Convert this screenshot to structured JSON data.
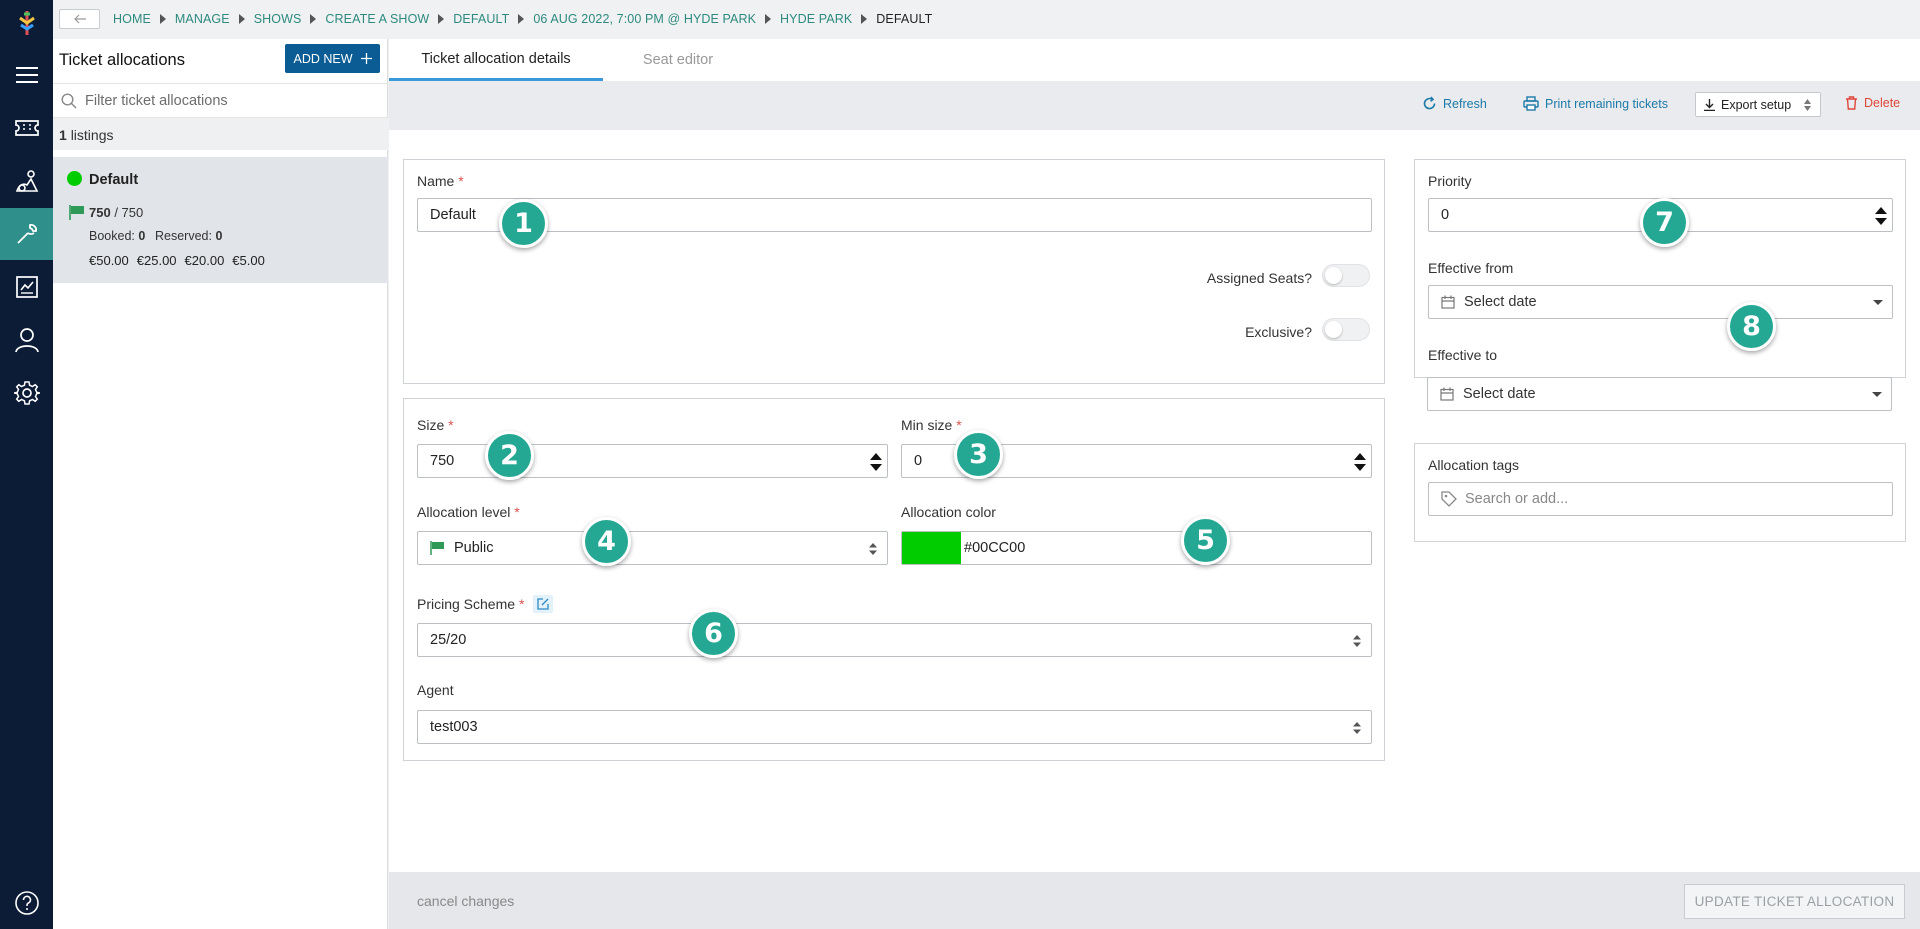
{
  "breadcrumb": [
    "HOME",
    "MANAGE",
    "SHOWS",
    "CREATE A SHOW",
    "DEFAULT",
    "06 AUG 2022, 7:00 PM @ HYDE PARK",
    "HYDE PARK"
  ],
  "breadcrumb_current": "DEFAULT",
  "sidebar": {
    "title": "Ticket allocations",
    "add_new_label": "ADD NEW",
    "filter_placeholder": "Filter ticket allocations",
    "count_number": "1",
    "count_label": "listings",
    "listing": {
      "name": "Default",
      "status_color": "#00CC00",
      "available": "750",
      "total": "/ 750",
      "booked_label": "Booked:",
      "booked": "0",
      "reserved_label": "Reserved:",
      "reserved": "0",
      "prices": [
        "€50.00",
        "€25.00",
        "€20.00",
        "€5.00"
      ]
    }
  },
  "tabs": [
    {
      "label": "Ticket allocation details",
      "active": true
    },
    {
      "label": "Seat editor",
      "active": false
    }
  ],
  "toolbar": {
    "refresh": "Refresh",
    "print": "Print remaining tickets",
    "export": "Export setup",
    "delete": "Delete"
  },
  "form": {
    "name_label": "Name",
    "name_value": "Default",
    "assigned_seats_label": "Assigned Seats?",
    "exclusive_label": "Exclusive?",
    "size_label": "Size",
    "size_value": "750",
    "min_size_label": "Min size",
    "min_size_value": "0",
    "allocation_level_label": "Allocation level",
    "allocation_level_value": "Public",
    "allocation_color_label": "Allocation color",
    "allocation_color_value": "#00CC00",
    "pricing_scheme_label": "Pricing Scheme",
    "pricing_scheme_value": "25/20",
    "agent_label": "Agent",
    "agent_value": "test003",
    "priority_label": "Priority",
    "priority_value": "0",
    "effective_from_label": "Effective from",
    "effective_from_placeholder": "Select date",
    "effective_to_label": "Effective to",
    "effective_to_placeholder": "Select date",
    "tags_label": "Allocation tags",
    "tags_placeholder": "Search or add..."
  },
  "required_mark": "*",
  "markers": [
    "1",
    "2",
    "3",
    "4",
    "5",
    "6",
    "7",
    "8"
  ],
  "footer": {
    "cancel": "cancel changes",
    "update": "UPDATE TICKET ALLOCATION"
  },
  "colors": {
    "rail": "#0c1c36",
    "accent": "#2c8a7e",
    "primary_button": "#0b5c94",
    "allocation_color": "#00CC00",
    "marker": "#25a893",
    "delete": "#e0453a"
  }
}
